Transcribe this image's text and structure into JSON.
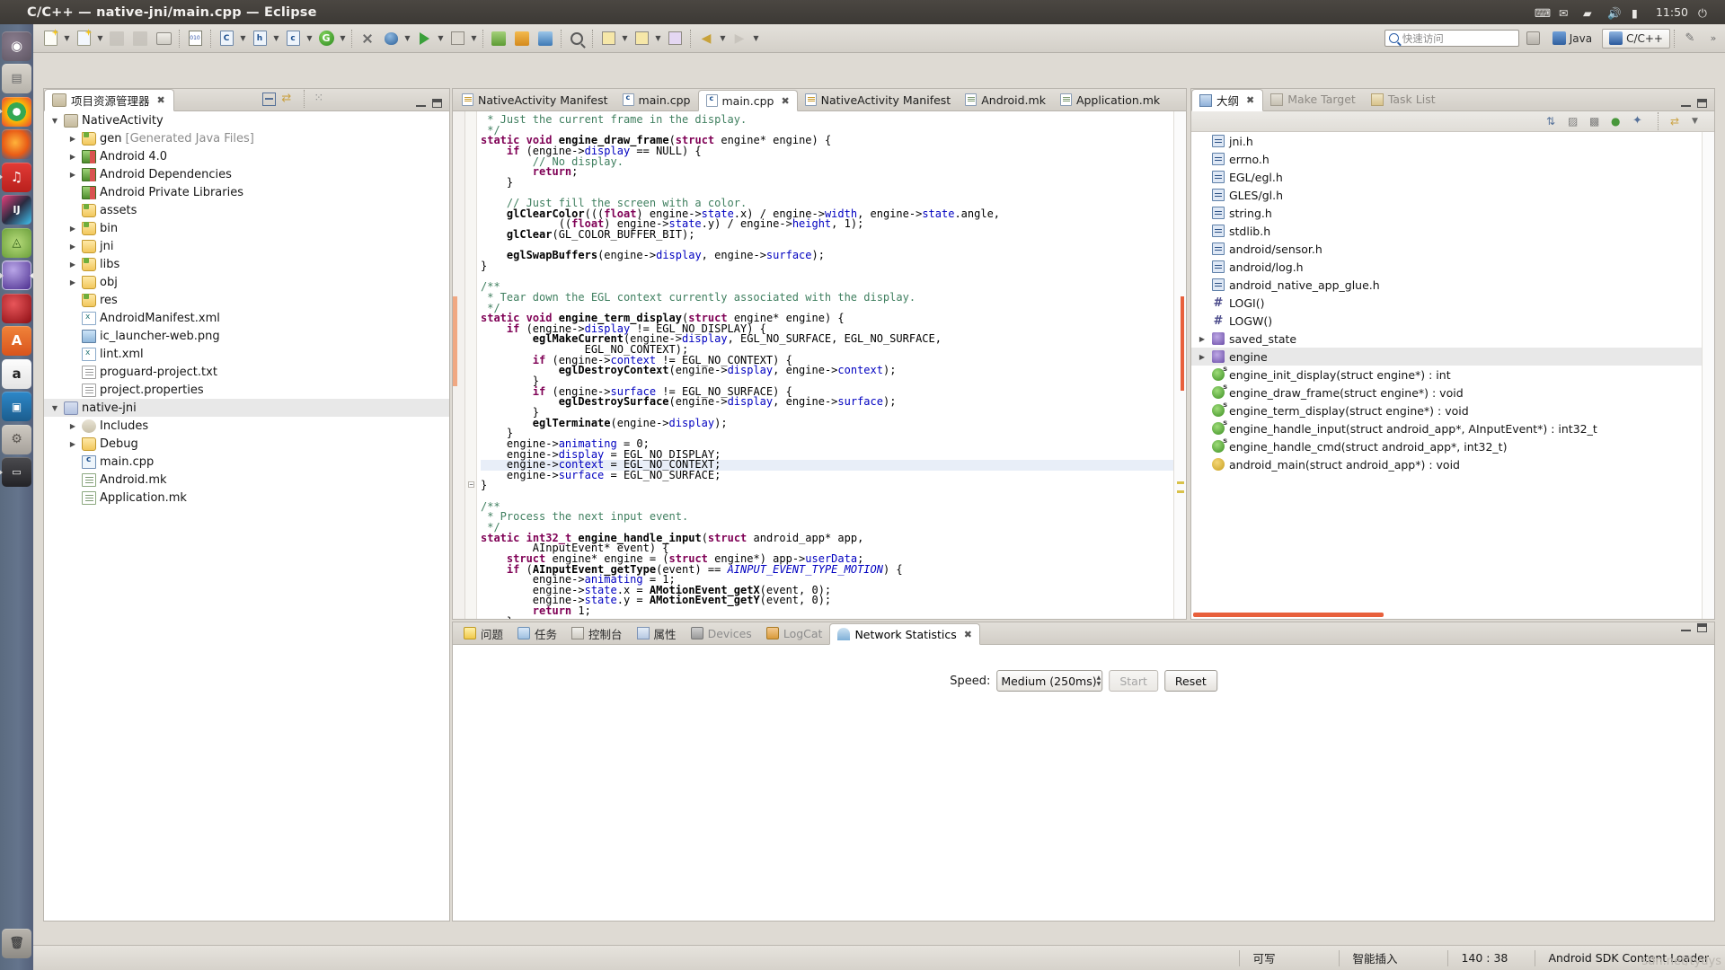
{
  "window": {
    "title": "C/C++ — native-jni/main.cpp — Eclipse",
    "clock": "11:50"
  },
  "launcher": {
    "items": [
      {
        "name": "ubuntu-dash",
        "label": "Ubuntu",
        "glyph": "●"
      },
      {
        "name": "files",
        "label": "Files",
        "glyph": "☰"
      },
      {
        "name": "chrome",
        "label": "Google Chrome",
        "glyph": ""
      },
      {
        "name": "firefox",
        "label": "Firefox",
        "glyph": ""
      },
      {
        "name": "netease-music",
        "label": "NetEase Cloud Music",
        "glyph": "♫"
      },
      {
        "name": "intellij-idea",
        "label": "IntelliJ IDEA",
        "glyph": "IJ"
      },
      {
        "name": "android-studio",
        "label": "Android Studio",
        "glyph": "A"
      },
      {
        "name": "eclipse",
        "label": "Eclipse",
        "glyph": ""
      },
      {
        "name": "ruby-gem",
        "label": "Ruby",
        "glyph": ""
      },
      {
        "name": "ubuntu-software",
        "label": "Ubuntu Software Center",
        "glyph": "A"
      },
      {
        "name": "amazon",
        "label": "Amazon",
        "glyph": "a"
      },
      {
        "name": "virtualbox",
        "label": "VirtualBox",
        "glyph": "▣"
      },
      {
        "name": "system-settings",
        "label": "System Settings",
        "glyph": "⚙"
      },
      {
        "name": "device-manager",
        "label": "Device",
        "glyph": "▭"
      }
    ]
  },
  "toolbar": {
    "quick_access_placeholder": "快速访问",
    "perspective_java": "Java",
    "perspective_cpp": "C/C++",
    "buttons": [
      {
        "name": "new-wizard",
        "label": "New"
      },
      {
        "name": "new-c-project",
        "label": "New C/C++ Project"
      },
      {
        "name": "save",
        "label": "Save"
      },
      {
        "name": "save-all",
        "label": "Save All"
      },
      {
        "name": "print",
        "label": "Print"
      },
      {
        "name": "binary",
        "label": "Binaries"
      },
      {
        "name": "new-class",
        "label": "New Class"
      },
      {
        "name": "new-header",
        "label": "New Header File"
      },
      {
        "name": "new-source",
        "label": "New Source File"
      },
      {
        "name": "build-all",
        "label": "Build All"
      },
      {
        "name": "skip-breakpoints",
        "label": "Skip All Breakpoints"
      },
      {
        "name": "debug",
        "label": "Debug"
      },
      {
        "name": "run",
        "label": "Run"
      },
      {
        "name": "external-tools",
        "label": "External Tools"
      },
      {
        "name": "new-android-project",
        "label": "New Android Project"
      },
      {
        "name": "android-sdk-manager",
        "label": "Android SDK Manager"
      },
      {
        "name": "android-avd-manager",
        "label": "Android Virtual Device Manager"
      },
      {
        "name": "search",
        "label": "Search"
      },
      {
        "name": "next-annotation",
        "label": "Next Annotation"
      },
      {
        "name": "previous-annotation",
        "label": "Previous Annotation"
      },
      {
        "name": "last-edit-location",
        "label": "Last Edit Location"
      },
      {
        "name": "back",
        "label": "Back"
      },
      {
        "name": "forward",
        "label": "Forward"
      }
    ]
  },
  "project_explorer": {
    "title": "项目资源管理器",
    "tools": [
      {
        "name": "collapse-all",
        "label": "Collapse All"
      },
      {
        "name": "link-with-editor",
        "label": "Link with Editor"
      },
      {
        "name": "view-menu",
        "label": "View Menu"
      }
    ],
    "tree": [
      {
        "label": "NativeActivity",
        "indent": 0,
        "twisty": "down",
        "icon": "proj"
      },
      {
        "label": "gen",
        "suffix": " [Generated Java Files]",
        "indent": 1,
        "twisty": "right",
        "icon": "srcfolder"
      },
      {
        "label": "Android 4.0",
        "indent": 1,
        "twisty": "right",
        "icon": "lib"
      },
      {
        "label": "Android Dependencies",
        "indent": 1,
        "twisty": "right",
        "icon": "lib"
      },
      {
        "label": "Android Private Libraries",
        "indent": 1,
        "twisty": "",
        "icon": "lib"
      },
      {
        "label": "assets",
        "indent": 1,
        "twisty": "",
        "icon": "srcfolder"
      },
      {
        "label": "bin",
        "indent": 1,
        "twisty": "right",
        "icon": "srcfolder"
      },
      {
        "label": "jni",
        "indent": 1,
        "twisty": "right",
        "icon": "folder"
      },
      {
        "label": "libs",
        "indent": 1,
        "twisty": "right",
        "icon": "srcfolder"
      },
      {
        "label": "obj",
        "indent": 1,
        "twisty": "right",
        "icon": "folder"
      },
      {
        "label": "res",
        "indent": 1,
        "twisty": "",
        "icon": "srcfolder"
      },
      {
        "label": "AndroidManifest.xml",
        "indent": 1,
        "twisty": "",
        "icon": "xml"
      },
      {
        "label": "ic_launcher-web.png",
        "indent": 1,
        "twisty": "",
        "icon": "png"
      },
      {
        "label": "lint.xml",
        "indent": 1,
        "twisty": "",
        "icon": "xml"
      },
      {
        "label": "proguard-project.txt",
        "indent": 1,
        "twisty": "",
        "icon": "file"
      },
      {
        "label": "project.properties",
        "indent": 1,
        "twisty": "",
        "icon": "file"
      },
      {
        "label": "native-jni",
        "indent": 0,
        "twisty": "down",
        "icon": "projc",
        "selected": true
      },
      {
        "label": "Includes",
        "indent": 1,
        "twisty": "right",
        "icon": "incl"
      },
      {
        "label": "Debug",
        "indent": 1,
        "twisty": "right",
        "icon": "folder"
      },
      {
        "label": "main.cpp",
        "indent": 1,
        "twisty": "",
        "icon": "cpp"
      },
      {
        "label": "Android.mk",
        "indent": 1,
        "twisty": "",
        "icon": "mk"
      },
      {
        "label": "Application.mk",
        "indent": 1,
        "twisty": "",
        "icon": "mk"
      }
    ]
  },
  "editor": {
    "tabs": [
      {
        "label": "NativeActivity Manifest",
        "icon": "mf",
        "active": false
      },
      {
        "label": "main.cpp",
        "icon": "cpp",
        "active": false
      },
      {
        "label": "main.cpp",
        "icon": "cpp",
        "active": true
      },
      {
        "label": "NativeActivity Manifest",
        "icon": "mf",
        "active": false
      },
      {
        "label": "Android.mk",
        "icon": "mk",
        "active": false
      },
      {
        "label": "Application.mk",
        "icon": "mk",
        "active": false
      }
    ],
    "close_glyph": "✖",
    "code_lines": [
      " * Just the current frame in the display.",
      " */",
      "static void engine_draw_frame(struct engine* engine) {",
      "    if (engine->display == NULL) {",
      "        // No display.",
      "        return;",
      "    }",
      "",
      "    // Just fill the screen with a color.",
      "    glClearColor(((float) engine->state.x) / engine->width, engine->state.angle,",
      "            ((float) engine->state.y) / engine->height, 1);",
      "    glClear(GL_COLOR_BUFFER_BIT);",
      "",
      "    eglSwapBuffers(engine->display, engine->surface);",
      "}",
      "",
      "/**",
      " * Tear down the EGL context currently associated with the display.",
      " */",
      "static void engine_term_display(struct engine* engine) {",
      "    if (engine->display != EGL_NO_DISPLAY) {",
      "        eglMakeCurrent(engine->display, EGL_NO_SURFACE, EGL_NO_SURFACE,",
      "                EGL_NO_CONTEXT);",
      "        if (engine->context != EGL_NO_CONTEXT) {",
      "            eglDestroyContext(engine->display, engine->context);",
      "        }",
      "        if (engine->surface != EGL_NO_SURFACE) {",
      "            eglDestroySurface(engine->display, engine->surface);",
      "        }",
      "        eglTerminate(engine->display);",
      "    }",
      "    engine->animating = 0;",
      "    engine->display = EGL_NO_DISPLAY;",
      "    engine->context = EGL_NO_CONTEXT;",
      "    engine->surface = EGL_NO_SURFACE;",
      "}",
      "",
      "/**",
      " * Process the next input event.",
      " */",
      "static int32_t engine_handle_input(struct android_app* app,",
      "        AInputEvent* event) {",
      "    struct engine* engine = (struct engine*) app->userData;",
      "    if (AInputEvent_getType(event) == AINPUT_EVENT_TYPE_MOTION) {",
      "        engine->animating = 1;",
      "        engine->state.x = AMotionEvent_getX(event, 0);",
      "        engine->state.y = AMotionEvent_getY(event, 0);",
      "        return 1;",
      "    }"
    ],
    "cursor_line_index": 33
  },
  "outline": {
    "title": "大纲",
    "make_target_title": "Make Target",
    "task_list_title": "Task List",
    "tools": [
      {
        "name": "sort",
        "label": "Sort"
      },
      {
        "name": "hide-fields",
        "label": "Hide Fields"
      },
      {
        "name": "hide-static",
        "label": "Hide Static Members"
      },
      {
        "name": "hide-non-public",
        "label": "Hide Non-Public Members"
      },
      {
        "name": "filters",
        "label": "Filters"
      },
      {
        "name": "link-with-editor",
        "label": "Link with Editor"
      },
      {
        "name": "view-menu",
        "label": "View Menu"
      }
    ],
    "items": [
      {
        "label": "jni.h",
        "icon": "include",
        "twisty": ""
      },
      {
        "label": "errno.h",
        "icon": "include",
        "twisty": ""
      },
      {
        "label": "EGL/egl.h",
        "icon": "include",
        "twisty": ""
      },
      {
        "label": "GLES/gl.h",
        "icon": "include",
        "twisty": ""
      },
      {
        "label": "string.h",
        "icon": "include",
        "twisty": ""
      },
      {
        "label": "stdlib.h",
        "icon": "include",
        "twisty": ""
      },
      {
        "label": "android/sensor.h",
        "icon": "include",
        "twisty": ""
      },
      {
        "label": "android/log.h",
        "icon": "include",
        "twisty": ""
      },
      {
        "label": "android_native_app_glue.h",
        "icon": "include",
        "twisty": ""
      },
      {
        "label": "LOGI()",
        "icon": "define",
        "twisty": ""
      },
      {
        "label": "LOGW()",
        "icon": "define",
        "twisty": ""
      },
      {
        "label": "saved_state",
        "icon": "struct",
        "twisty": "right"
      },
      {
        "label": "engine",
        "icon": "struct",
        "twisty": "right",
        "selected": true
      },
      {
        "label": "engine_init_display(struct engine*) : int",
        "icon": "func",
        "twisty": "",
        "static": true
      },
      {
        "label": "engine_draw_frame(struct engine*) : void",
        "icon": "func",
        "twisty": "",
        "static": true
      },
      {
        "label": "engine_term_display(struct engine*) : void",
        "icon": "func",
        "twisty": "",
        "static": true
      },
      {
        "label": "engine_handle_input(struct android_app*, AInputEvent*) : int32_t",
        "icon": "func",
        "twisty": "",
        "static": true
      },
      {
        "label": "engine_handle_cmd(struct android_app*, int32_t)",
        "icon": "func",
        "twisty": "",
        "static": true
      },
      {
        "label": "android_main(struct android_app*) : void",
        "icon": "func-y",
        "twisty": ""
      }
    ]
  },
  "bottom_panel": {
    "tabs": [
      {
        "label": "问题",
        "icon": "problems",
        "active": false
      },
      {
        "label": "任务",
        "icon": "tasks",
        "active": false
      },
      {
        "label": "控制台",
        "icon": "console",
        "active": false
      },
      {
        "label": "属性",
        "icon": "props",
        "active": false
      },
      {
        "label": "Devices",
        "icon": "devices",
        "active": false,
        "dim": true
      },
      {
        "label": "LogCat",
        "icon": "logcat",
        "active": false,
        "dim": true
      },
      {
        "label": "Network Statistics",
        "icon": "net",
        "active": true
      }
    ],
    "close_glyph": "✖",
    "speed_label": "Speed:",
    "speed_value": "Medium (250ms)",
    "start_label": "Start",
    "reset_label": "Reset"
  },
  "statusbar": {
    "writable": "可写",
    "insert_mode": "智能插入",
    "position": "140 : 38",
    "loader": "Android SDK Content Loader",
    "watermark": "sdn.net/tydys"
  }
}
